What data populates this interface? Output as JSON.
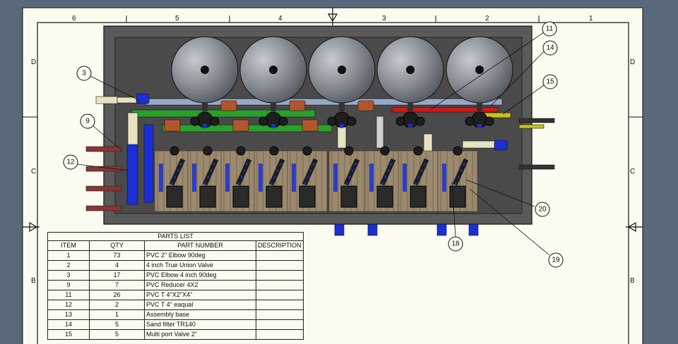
{
  "zones": {
    "columns": [
      "6",
      "5",
      "4",
      "3",
      "2",
      "1"
    ],
    "rows": [
      "D",
      "C",
      "B"
    ]
  },
  "balloons": [
    "3",
    "9",
    "12",
    "11",
    "14",
    "15",
    "20",
    "18",
    "19"
  ],
  "parts_list": {
    "title": "PARTS LIST",
    "headers": [
      "ITEM",
      "QTY",
      "PART NUMBER",
      "DESCRIPTION"
    ],
    "rows": [
      {
        "item": "1",
        "qty": "73",
        "part": "PVC 2\" Elbow 90deg",
        "desc": ""
      },
      {
        "item": "2",
        "qty": "4",
        "part": "4 inch True Union Valve",
        "desc": ""
      },
      {
        "item": "3",
        "qty": "17",
        "part": "PVC Elbow 4 inch  90deg",
        "desc": ""
      },
      {
        "item": "9",
        "qty": "7",
        "part": "PVC Reducer 4X2",
        "desc": ""
      },
      {
        "item": "11",
        "qty": "26",
        "part": "PVC T 4\"X2\"X4\"",
        "desc": ""
      },
      {
        "item": "12",
        "qty": "2",
        "part": "PVC T 4\" eaqual",
        "desc": ""
      },
      {
        "item": "13",
        "qty": "1",
        "part": "Assembly base",
        "desc": ""
      },
      {
        "item": "14",
        "qty": "5",
        "part": "Sand filter TR140",
        "desc": ""
      },
      {
        "item": "15",
        "qty": "5",
        "part": "Multi port Valve 2\"",
        "desc": ""
      }
    ]
  },
  "colors": {
    "background": "#59687a",
    "sheet": "#fbfbf0",
    "base_plate": "#5a5a5a",
    "pipe_blue": "#1a2fd6",
    "pipe_green": "#2aa02a",
    "pipe_red": "#d01818",
    "pipe_cream": "#e8e2c0",
    "tank": "#8a8e94"
  }
}
